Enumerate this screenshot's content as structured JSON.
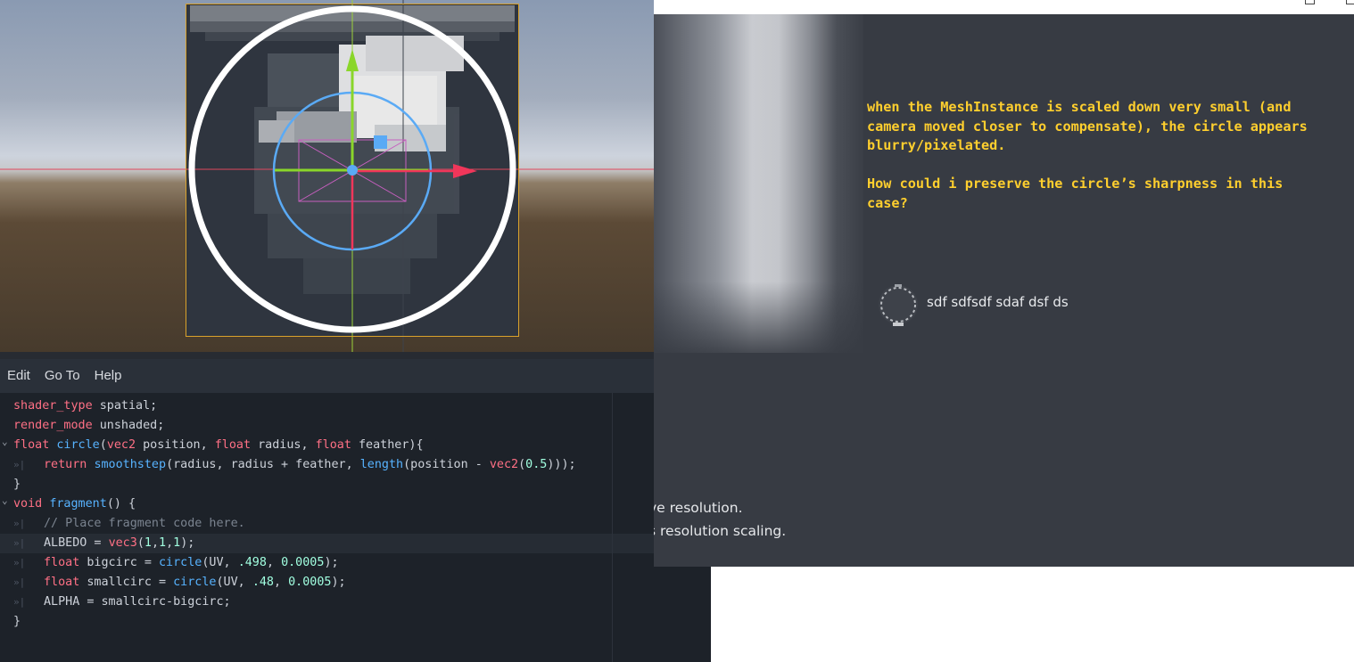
{
  "editor": {
    "menu": [
      "Edit",
      "Go To",
      "Help"
    ],
    "code_lines": [
      {
        "fold": "",
        "indent": false,
        "tokens": [
          [
            "kw",
            "shader_type"
          ],
          [
            "id",
            " spatial;"
          ]
        ]
      },
      {
        "fold": "",
        "indent": false,
        "tokens": [
          [
            "kw",
            "render_mode"
          ],
          [
            "id",
            " unshaded;"
          ]
        ]
      },
      {
        "fold": "v",
        "indent": false,
        "tokens": [
          [
            "ty",
            "float"
          ],
          [
            "id",
            " "
          ],
          [
            "fn",
            "circle"
          ],
          [
            "id",
            "("
          ],
          [
            "ty",
            "vec2"
          ],
          [
            "id",
            " position, "
          ],
          [
            "ty",
            "float"
          ],
          [
            "id",
            " radius, "
          ],
          [
            "ty",
            "float"
          ],
          [
            "id",
            " feather){"
          ]
        ]
      },
      {
        "fold": "",
        "indent": true,
        "tokens": [
          [
            "kw",
            "return"
          ],
          [
            "id",
            " "
          ],
          [
            "fn",
            "smoothstep"
          ],
          [
            "id",
            "(radius, radius + feather, "
          ],
          [
            "fn",
            "length"
          ],
          [
            "id",
            "(position - "
          ],
          [
            "ty",
            "vec2"
          ],
          [
            "id",
            "("
          ],
          [
            "num",
            "0.5"
          ],
          [
            "id",
            ")));"
          ]
        ]
      },
      {
        "fold": "",
        "indent": false,
        "tokens": [
          [
            "id",
            "}"
          ]
        ]
      },
      {
        "fold": "v",
        "indent": false,
        "tokens": [
          [
            "kw",
            "void"
          ],
          [
            "id",
            " "
          ],
          [
            "fn",
            "fragment"
          ],
          [
            "id",
            "() {"
          ]
        ]
      },
      {
        "fold": "",
        "indent": true,
        "tokens": [
          [
            "cm",
            "// Place fragment code here."
          ]
        ]
      },
      {
        "fold": "",
        "indent": true,
        "active": true,
        "tokens": [
          [
            "id",
            "ALBEDO = "
          ],
          [
            "ty",
            "vec3"
          ],
          [
            "id",
            "("
          ],
          [
            "num",
            "1"
          ],
          [
            "id",
            ","
          ],
          [
            "num",
            "1"
          ],
          [
            "id",
            ","
          ],
          [
            "num",
            "1"
          ],
          [
            "id",
            ");"
          ]
        ]
      },
      {
        "fold": "",
        "indent": true,
        "tokens": [
          [
            "ty",
            "float"
          ],
          [
            "id",
            " bigcirc = "
          ],
          [
            "fn",
            "circle"
          ],
          [
            "id",
            "(UV, "
          ],
          [
            "num",
            ".498"
          ],
          [
            "id",
            ", "
          ],
          [
            "num",
            "0.0005"
          ],
          [
            "id",
            ");"
          ]
        ]
      },
      {
        "fold": "",
        "indent": true,
        "tokens": [
          [
            "ty",
            "float"
          ],
          [
            "id",
            " smallcirc = "
          ],
          [
            "fn",
            "circle"
          ],
          [
            "id",
            "(UV, "
          ],
          [
            "num",
            ".48"
          ],
          [
            "id",
            ", "
          ],
          [
            "num",
            "0.0005"
          ],
          [
            "id",
            ");"
          ]
        ]
      },
      {
        "fold": "",
        "indent": true,
        "tokens": [
          [
            "id",
            "ALPHA = smallcirc-bigcirc;"
          ]
        ]
      },
      {
        "fold": "",
        "indent": false,
        "tokens": [
          [
            "id",
            "}"
          ]
        ]
      }
    ],
    "tab_glyph": "»|"
  },
  "post": {
    "question": "when the MeshInstance is scaled down very small (and\ncamera moved closer to compensate), the circle appears\nblurry/pixelated.\n\nHow could i preserve the circle’s sharpness in this\ncase?",
    "username": "sdf sdfsdf sdaf dsf ds",
    "partial_line_1": "ve resolution.",
    "partial_line_2": "s resolution scaling."
  },
  "colors": {
    "accent_yellow": "#ffcf2e",
    "gizmo_blue": "#5aaaf5",
    "gizmo_green": "#8ad62a",
    "gizmo_red": "#f0365a",
    "selection_orange": "#d9a22c"
  }
}
